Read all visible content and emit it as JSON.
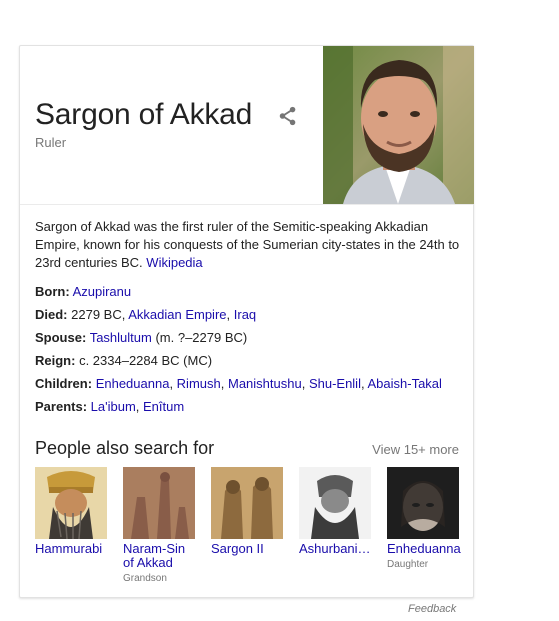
{
  "panel": {
    "title": "Sargon of Akkad",
    "subtitle": "Ruler",
    "share_icon": "share-icon",
    "description": "Sargon of Akkad was the first ruler of the Semitic-speaking Akkadian Empire, known for his conquests of the Sumerian city-states in the 24th to 23rd centuries BC.",
    "source_link": "Wikipedia"
  },
  "facts": {
    "born": {
      "label": "Born:",
      "links": [
        "Azupiranu"
      ]
    },
    "died": {
      "label": "Died:",
      "text": "2279 BC,",
      "links": [
        "Akkadian Empire",
        "Iraq"
      ]
    },
    "spouse": {
      "label": "Spouse:",
      "links": [
        "Tashlultum"
      ],
      "text": "(m. ?–2279 BC)"
    },
    "reign": {
      "label": "Reign:",
      "text": "c. 2334–2284 BC (MC)"
    },
    "children": {
      "label": "Children:",
      "links": [
        "Enheduanna",
        "Rimush",
        "Manishtushu",
        "Shu-Enlil",
        "Abaish-Takal"
      ]
    },
    "parents": {
      "label": "Parents:",
      "links": [
        "La'ibum",
        "Enîtum"
      ]
    }
  },
  "people": {
    "title": "People also search for",
    "view_more": "View 15+ more",
    "items": [
      {
        "name": "Hammurabi",
        "sub": ""
      },
      {
        "name": "Naram-Sin of Akkad",
        "sub": "Grandson"
      },
      {
        "name": "Sargon II",
        "sub": ""
      },
      {
        "name": "Ashurbani…",
        "sub": ""
      },
      {
        "name": "Enheduanna",
        "sub": "Daughter"
      }
    ]
  },
  "footer": {
    "feedback": "Feedback"
  },
  "colors": {
    "link": "#1a0dab",
    "muted": "#777777",
    "text": "#222222",
    "border": "#e2e2e2"
  }
}
